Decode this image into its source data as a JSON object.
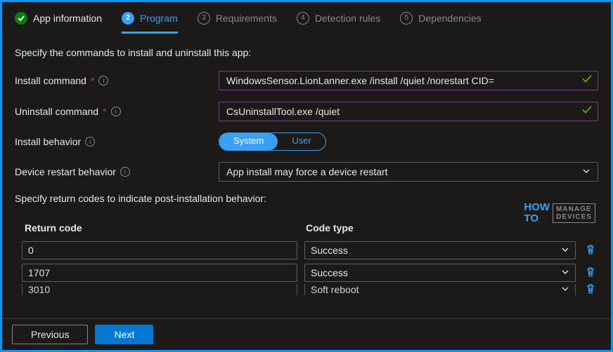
{
  "tabs": [
    {
      "label": "App information"
    },
    {
      "label": "Program",
      "num": "2"
    },
    {
      "label": "Requirements",
      "num": "3"
    },
    {
      "label": "Detection rules",
      "num": "4"
    },
    {
      "label": "Dependencies",
      "num": "5"
    }
  ],
  "intro": "Specify the commands to install and uninstall this app:",
  "fields": {
    "install_label": "Install command",
    "install_value": "WindowsSensor.LionLanner.exe /install /quiet /norestart CID=",
    "uninstall_label": "Uninstall command",
    "uninstall_value": "CsUninstallTool.exe /quiet",
    "behavior_label": "Install behavior",
    "behavior_options": {
      "system": "System",
      "user": "User"
    },
    "restart_label": "Device restart behavior",
    "restart_value": "App install may force a device restart"
  },
  "return_section": "Specify return codes to indicate post-installation behavior:",
  "table": {
    "head_code": "Return code",
    "head_type": "Code type",
    "rows": [
      {
        "code": "0",
        "type": "Success"
      },
      {
        "code": "1707",
        "type": "Success"
      },
      {
        "code": "3010",
        "type": "Soft reboot"
      }
    ]
  },
  "footer": {
    "prev": "Previous",
    "next": "Next"
  },
  "watermark": {
    "how": "HOW",
    "to": "TO",
    "md1": "MANAGE",
    "md2": "DEVICES"
  },
  "required_marker": "*"
}
